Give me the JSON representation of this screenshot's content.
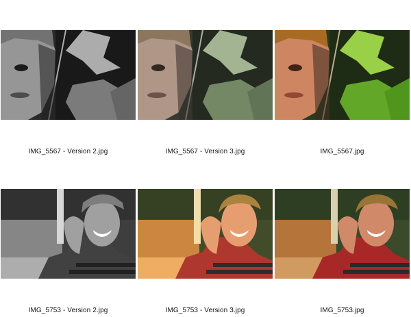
{
  "photos": [
    {
      "filename": "IMG_5567 - Version 2.jpg",
      "style": "grayscale"
    },
    {
      "filename": "IMG_5567 - Version 3.jpg",
      "style": "muted"
    },
    {
      "filename": "IMG_5567.jpg",
      "style": "color"
    },
    {
      "filename": "IMG_5753 - Version 2.jpg",
      "style": "grayscale"
    },
    {
      "filename": "IMG_5753 - Version 3.jpg",
      "style": "warm"
    },
    {
      "filename": "IMG_5753.jpg",
      "style": "color"
    }
  ]
}
